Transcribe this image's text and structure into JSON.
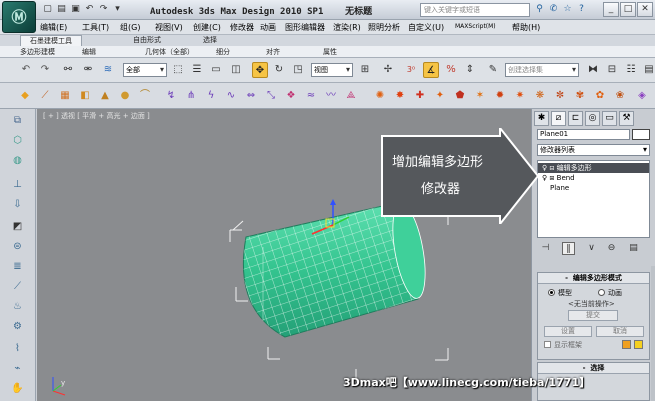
{
  "window": {
    "logo_text": "Ⓜ",
    "title": "Autodesk 3ds Max Design 2010 SP1",
    "doc_name": "无标题",
    "search_placeholder": "键入关键字或短语",
    "buttons": {
      "minimize": "_",
      "maximize": "□",
      "close": "✕"
    }
  },
  "menu": {
    "items": [
      "编辑(E)",
      "工具(T)",
      "组(G)",
      "视图(V)",
      "创建(C)",
      "修改器",
      "动画",
      "图形编辑器",
      "渲染(R)",
      "照明分析",
      "自定义(U)",
      "MAXScript(M)",
      "帮助(H)"
    ]
  },
  "ribbon": {
    "tabs": [
      "石墨建模工具",
      "自由形式",
      "选择"
    ],
    "subtabs": [
      "多边形建模",
      "编辑",
      "几何体（全部）",
      "细分",
      "对齐",
      "属性"
    ]
  },
  "toolbar": {
    "filter_value": "全部",
    "ref_coord_value": "视图",
    "named_selection_placeholder": "创建选择集"
  },
  "viewport": {
    "label": "[ + ] 透视 [ 平滑 + 高光 + 边面 ]",
    "axis_label": "y"
  },
  "callout": {
    "line1": "增加编辑多边形",
    "line2": "修改器"
  },
  "watermark": "3Dmax吧【www.linecg.com/tieba/1771】",
  "command_panel": {
    "object_name": "Plane01",
    "modifier_list": "修改器列表",
    "stack": [
      "编辑多边形",
      "Bend",
      "Plane"
    ],
    "rollout_title": "编辑多边形模式",
    "mode_model": "模型",
    "mode_anim": "动画",
    "no_op": "<无当前操作>",
    "commit": "提交",
    "settings": "设置",
    "cancel": "取消",
    "show_cage": "显示框架",
    "selection_title": "选择"
  },
  "colors": {
    "cylinder": "#3ccf9a",
    "selected_stack": "#4a4e55",
    "callout_fill": "#5a5d61",
    "accent": "#f0a020"
  }
}
